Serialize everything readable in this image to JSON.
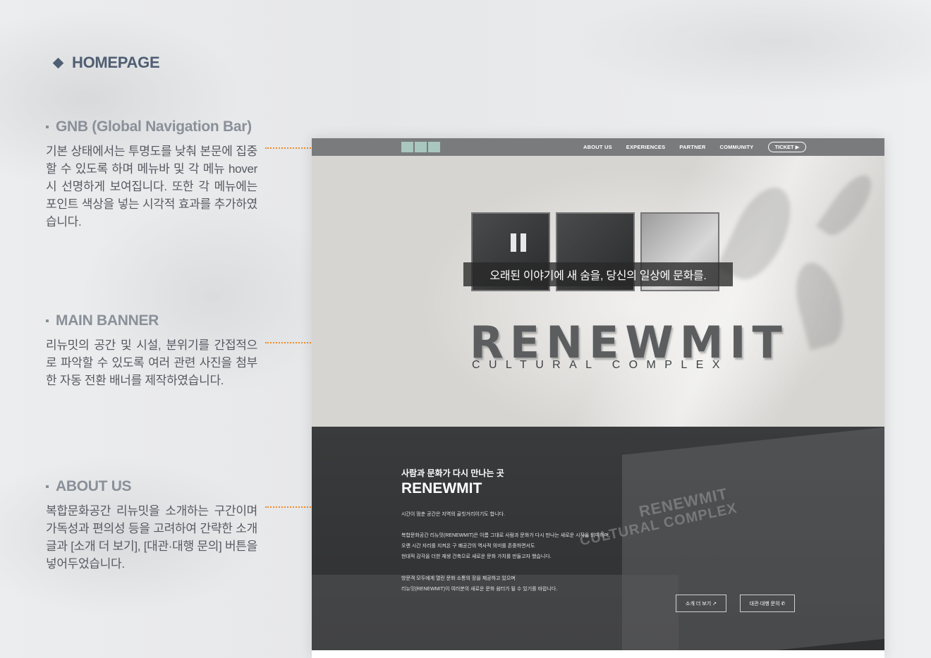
{
  "page": {
    "section_title": "HOMEPAGE",
    "accent_color": "#f08a24",
    "text_color": "#4f5e72"
  },
  "notes": [
    {
      "title": "GNB (Global Navigation Bar)",
      "desc": "기본 상태에서는 투명도를 낮춰 본문에 집중할 수 있도록 하며 메뉴바 및 각 메뉴 hover 시 선명하게 보여집니다. 또한 각 메뉴에는 포인트 색상을 넣는 시각적 효과를 추가하였습니다."
    },
    {
      "title": "MAIN BANNER",
      "desc": "리뉴밋의 공간 및 시설, 분위기를 간접적으로 파악할 수 있도록 여러 관련 사진을 첨부한 자동 전환 배너를 제작하였습니다."
    },
    {
      "title": "ABOUT US",
      "desc": "복합문화공간 리뉴밋을 소개하는 구간이며 가독성과 편의성 등을 고려하여 간략한 소개글과 [소개 더 보기], [대관·대행 문의] 버튼을 넣어두었습니다."
    }
  ],
  "mockup": {
    "nav": [
      "ABOUT US",
      "EXPERIENCES",
      "PARTNER",
      "COMMUNITY"
    ],
    "ticket": "TICKET ▶",
    "banner": {
      "tagline": "오래된 이야기에 새 숨을, 당신의 일상에 문화를.",
      "brand": "RENEWMIT",
      "brand_sub": "CULTURAL COMPLEX"
    },
    "about": {
      "subtitle": "사람과 문화가 다시 만나는 곳",
      "title": "RENEWMIT",
      "p1": "시간이 멈춘 공간은 지역의 골칫거리이기도 합니다.",
      "p2": "복합문화공간 리뉴밋(RENEWMIT)은 이름 그대로 사람과 문화가 다시 만나는 새로운 시작을 의미하며,",
      "p3": "오랜 시간 자리를 지켜온 구 폐공간의 역사적 의미를 존중하면서도",
      "p4": "현대적 감각을 더한 재생 건축으로 새로운 문화 가치를 만들고자 했습니다.",
      "p5": "방문객 모두에게 열린 문화 소통의 장을 제공하고 있으며",
      "p6": "리뉴밋(RENEWMIT)이 여러분의 새로운 문화 쉼터가 될 수 있기를 바랍니다.",
      "btn_more": "소개 더 보기 ↗",
      "btn_rent": "대관·대행 문의 ✆",
      "building_text1": "RENEWMIT",
      "building_text2": "CULTURAL COMPLEX"
    }
  }
}
